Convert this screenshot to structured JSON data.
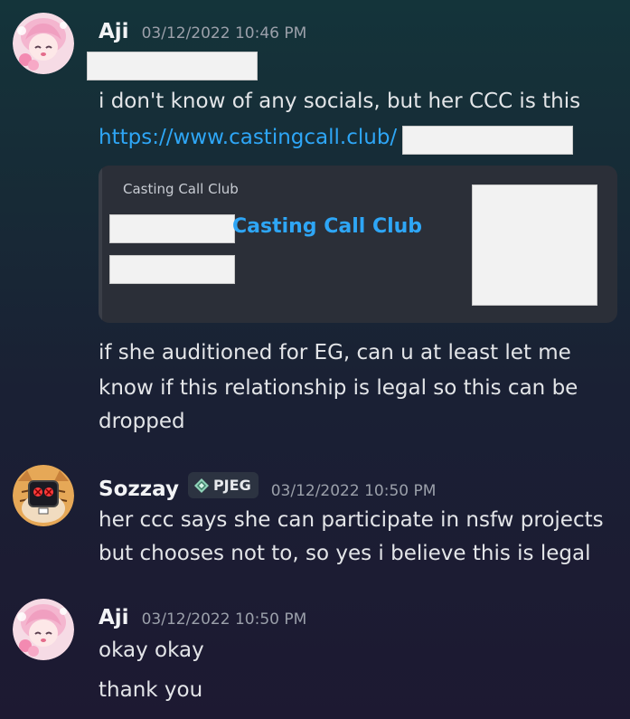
{
  "messages": [
    {
      "username": "Aji",
      "timestamp": "03/12/2022 10:46 PM",
      "text_line_1": "i don't know of any socials, but her CCC is this",
      "link_text": "https://www.castingcall.club/",
      "embed": {
        "provider": "Casting Call Club",
        "title": "Casting Call Club"
      },
      "text_line_2": "if she auditioned for EG, can u at least let me",
      "text_line_3": "know if this relationship is legal so this can be",
      "text_line_4": "dropped"
    },
    {
      "username": "Sozzay",
      "role": "PJEG",
      "timestamp": "03/12/2022 10:50 PM",
      "text_line_1": "her ccc says she can participate in nsfw projects",
      "text_line_2": "but chooses not to, so yes i believe this is legal"
    },
    {
      "username": "Aji",
      "timestamp": "03/12/2022 10:50 PM",
      "text_line_1": "okay okay",
      "text_line_2": "thank you"
    }
  ],
  "colors": {
    "link": "#2ea6f6",
    "timestamp": "#9ba0aa",
    "embed_background": "#2b2f38"
  },
  "icons": {
    "aji_avatar": "anime-girl-avatar-icon",
    "sozzay_avatar": "tiger-robot-avatar-icon",
    "role_icon": "diamond-role-icon"
  }
}
